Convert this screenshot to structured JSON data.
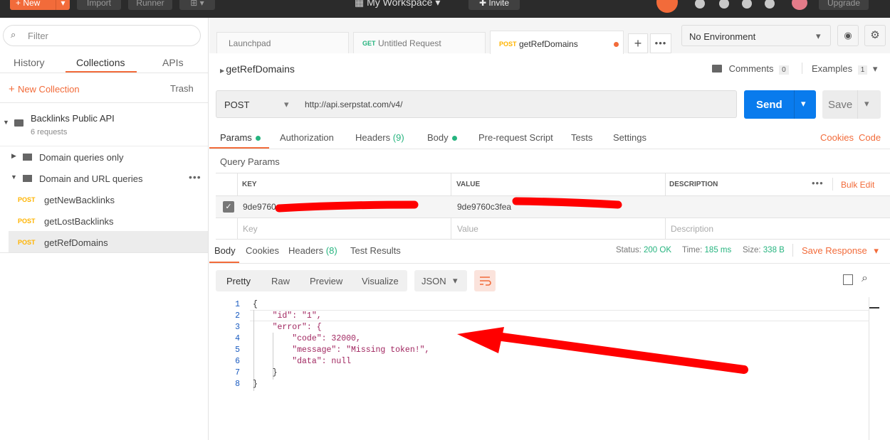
{
  "topbar": {
    "new_label": "New",
    "import_label": "Import",
    "runner_label": "Runner",
    "workspace_label": "My Workspace",
    "invite_label": "Invite",
    "upgrade_label": "Upgrade"
  },
  "sidebar": {
    "filter_placeholder": "Filter",
    "tabs": [
      "History",
      "Collections",
      "APIs"
    ],
    "new_collection_label": "New Collection",
    "trash_label": "Trash",
    "collection": {
      "name": "Backlinks Public API",
      "count": "6 requests"
    },
    "folders": [
      "Domain queries only",
      "Domain and URL queries"
    ],
    "requests": [
      {
        "method": "POST",
        "name": "getNewBacklinks"
      },
      {
        "method": "POST",
        "name": "getLostBacklinks"
      },
      {
        "method": "POST",
        "name": "getRefDomains"
      }
    ]
  },
  "tabs": [
    {
      "method": "",
      "label": "Launchpad"
    },
    {
      "method": "GET",
      "label": "Untitled Request"
    },
    {
      "method": "POST",
      "label": "getRefDomains"
    }
  ],
  "environment": {
    "selected": "No Environment"
  },
  "request": {
    "name": "getRefDomains",
    "comments_label": "Comments",
    "comments_count": "0",
    "examples_label": "Examples",
    "examples_count": "1",
    "method": "POST",
    "url": "http://api.serpstat.com/v4/",
    "send_label": "Send",
    "save_label": "Save",
    "tabs": [
      "Params",
      "Authorization",
      "Headers",
      "Body",
      "Pre-request Script",
      "Tests",
      "Settings"
    ],
    "headers_count": "(9)",
    "cookies_label": "Cookies",
    "code_label": "Code"
  },
  "query": {
    "title": "Query Params",
    "columns": [
      "KEY",
      "VALUE",
      "DESCRIPTION"
    ],
    "bulk_edit_label": "Bulk Edit",
    "row": {
      "key": "9de9760",
      "value": "9de9760c3fea"
    },
    "placeholders": {
      "key": "Key",
      "value": "Value",
      "description": "Description"
    }
  },
  "response": {
    "tabs": [
      "Body",
      "Cookies",
      "Headers",
      "Test Results"
    ],
    "headers_count": "(8)",
    "status_label": "Status:",
    "status": "200 OK",
    "time_label": "Time:",
    "time": "185 ms",
    "size_label": "Size:",
    "size": "338 B",
    "save_response_label": "Save Response",
    "view_tabs": [
      "Pretty",
      "Raw",
      "Preview",
      "Visualize"
    ],
    "format": "JSON",
    "lines": [
      "{",
      "    \"id\": \"1\",",
      "    \"error\": {",
      "        \"code\": 32000,",
      "        \"message\": \"Missing token!\",",
      "        \"data\": null",
      "    }",
      "}"
    ]
  },
  "annotation_color": "#ff0000"
}
